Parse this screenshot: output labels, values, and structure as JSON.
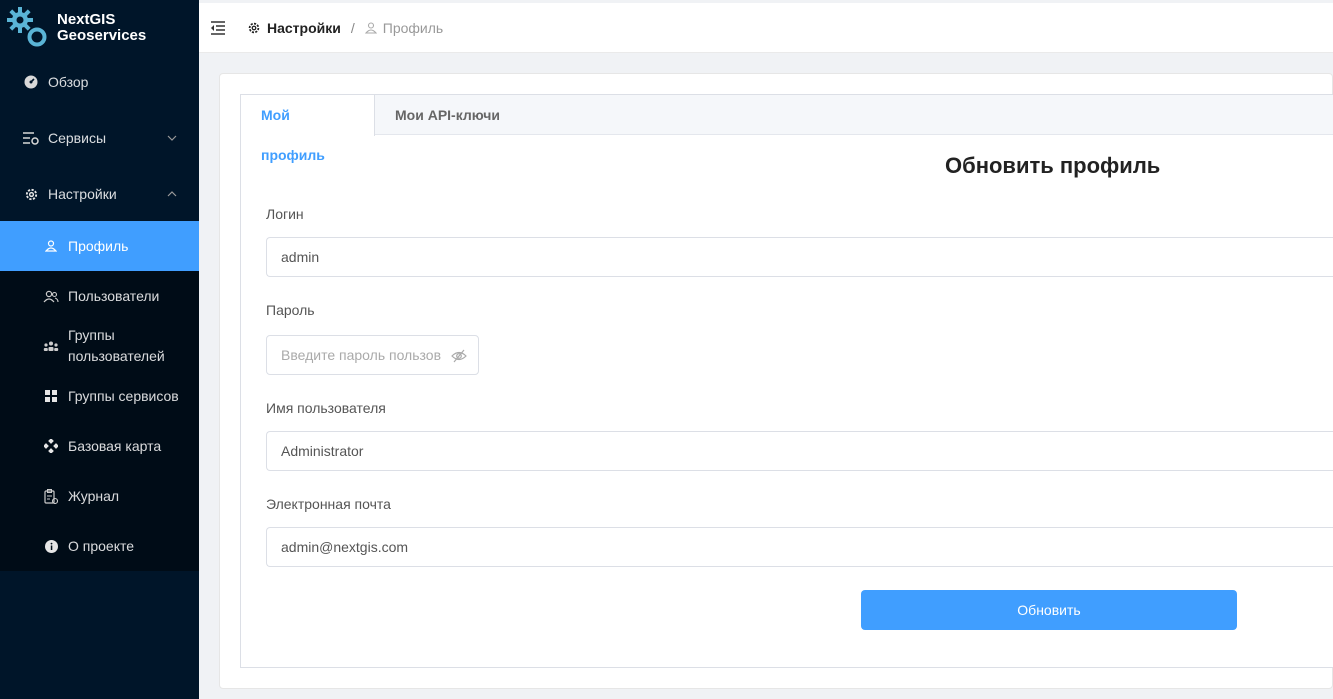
{
  "logo": {
    "line1": "NextGIS",
    "line2": "Geoservices",
    "icon": "gears-icon"
  },
  "sidebar": {
    "items": [
      {
        "label": "Обзор",
        "icon": "dashboard-icon"
      },
      {
        "label": "Сервисы",
        "icon": "services-icon"
      },
      {
        "label": "Настройки",
        "icon": "gear-icon"
      }
    ],
    "submenu": [
      {
        "label": "Профиль",
        "icon": "user-icon",
        "active": true
      },
      {
        "label": "Пользователи",
        "icon": "users-icon"
      },
      {
        "label": "Группы пользователей",
        "icon": "user-groups-icon"
      },
      {
        "label": "Группы сервисов",
        "icon": "grid-icon"
      },
      {
        "label": "Базовая карта",
        "icon": "tiles-icon"
      },
      {
        "label": "Журнал",
        "icon": "journal-icon"
      },
      {
        "label": "О проекте",
        "icon": "info-icon"
      }
    ]
  },
  "breadcrumb": {
    "item1": "Настройки",
    "separator": "/",
    "item2": "Профиль"
  },
  "tabs": [
    {
      "label": "Мой профиль"
    },
    {
      "label": "Мои API-ключи"
    }
  ],
  "form": {
    "title": "Обновить профиль",
    "login_label": "Логин",
    "login_value": "admin",
    "password_label": "Пароль",
    "password_placeholder": "Введите пароль пользов",
    "username_label": "Имя пользователя",
    "username_value": "Administrator",
    "email_label": "Электронная почта",
    "email_value": "admin@nextgis.com",
    "submit_label": "Обновить"
  },
  "colors": {
    "sidebar": "#001529",
    "submenu": "#000c17",
    "accent": "#409eff"
  }
}
